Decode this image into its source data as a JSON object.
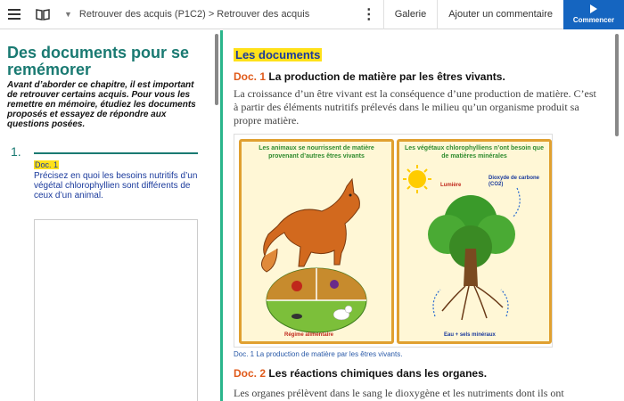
{
  "topbar": {
    "breadcrumb": "Retrouver des acquis (P1C2) > Retrouver des acquis",
    "gallery_label": "Galerie",
    "comment_label": "Ajouter un commentaire",
    "start_label": "Commencer",
    "icons": [
      "menu-icon",
      "book-icon",
      "chevron-down-icon",
      "kebab-icon",
      "play-icon"
    ]
  },
  "left": {
    "title": "Des documents pour se remémorer",
    "intro": "Avant d’aborder ce chapitre, il est important de retrouver certains acquis. Pour vous les remettre en mémoire, étudiez les documents proposés et essayez de répondre aux questions posées.",
    "question": {
      "number": "1.",
      "tag": "Doc. 1",
      "text": "Précisez en quoi les besoins nutritifs d’un végétal chlorophyllien sont différents de ceux d’un animal."
    }
  },
  "right": {
    "section_title": "Les documents",
    "doc1": {
      "num": "Doc. 1",
      "title": "La production de matière par les êtres vivants.",
      "text": "La croissance d’un être vivant est la conséquence d’une production de matière. C’est à partir des éléments nutritifs prélevés dans le milieu qu’un organisme produit sa propre matière."
    },
    "figure": {
      "left_title": "Les animaux se nourrissent de matière provenant d’autres êtres vivants",
      "right_title": "Les végétaux chlorophylliens n’ont besoin que de matières minérales",
      "diet_label": "Régime alimentaire",
      "light_label": "Lumière",
      "co2_label": "Dioxyde de carbone (CO2)",
      "water_label": "Eau + sels minéraux",
      "caption": "Doc. 1 La production de matière par les êtres vivants."
    },
    "doc2": {
      "num": "Doc. 2",
      "title": "Les réactions chimiques dans les organes.",
      "text": "Les organes prélèvent dans le sang le dioxygène et les nutriments dont ils ont"
    }
  },
  "colors": {
    "accent_teal": "#1a7a72",
    "divider_green": "#2bb58b",
    "start_blue": "#1565c0",
    "highlight_yellow": "#ffe11a",
    "doc_orange": "#e05a1a"
  }
}
